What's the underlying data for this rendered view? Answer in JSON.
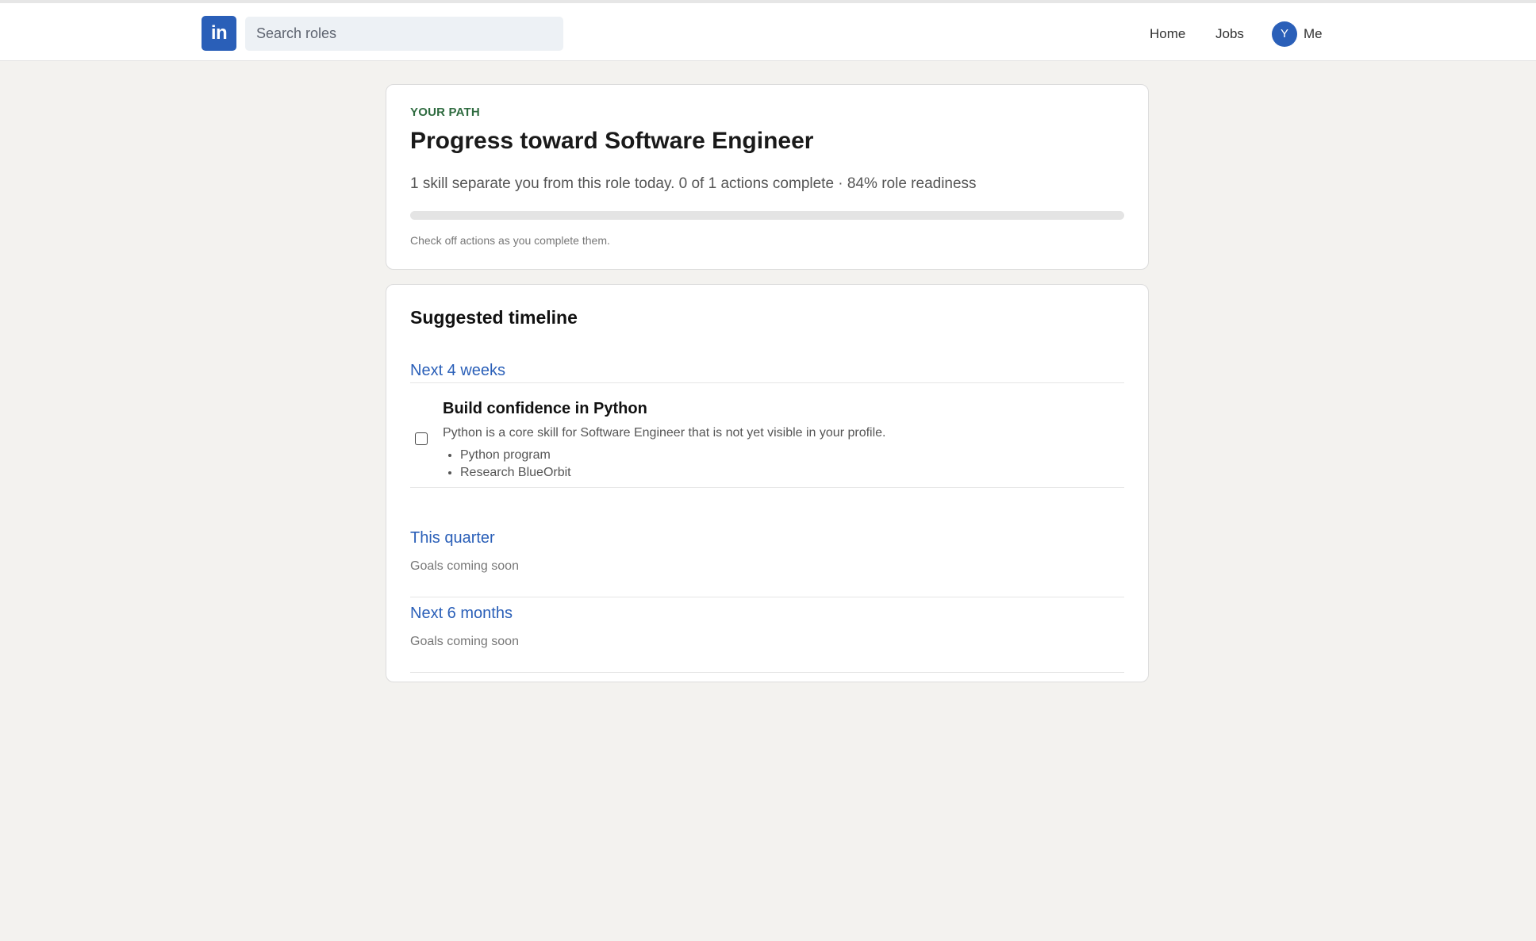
{
  "header": {
    "logo_text": "in",
    "search_placeholder": "Search roles",
    "nav": {
      "home": "Home",
      "jobs": "Jobs",
      "me": "Me",
      "avatar_initial": "Y"
    }
  },
  "progress": {
    "eyebrow": "YOUR PATH",
    "title": "Progress toward Software Engineer",
    "summary": "1 skill separate you from this role today. 0 of 1 actions complete · 84% role readiness",
    "actions_completed_fraction": 0,
    "hint": "Check off actions as you complete them."
  },
  "timeline": {
    "title": "Suggested timeline",
    "periods": [
      {
        "label": "Next 4 weeks",
        "actions": [
          {
            "title": "Build confidence in Python",
            "description": "Python is a core skill for Software Engineer that is not yet visible in your profile.",
            "checked": false,
            "resources": [
              "Python program",
              "Research BlueOrbit"
            ]
          }
        ]
      },
      {
        "label": "This quarter",
        "empty_text": "Goals coming soon"
      },
      {
        "label": "Next 6 months",
        "empty_text": "Goals coming soon"
      }
    ]
  },
  "colors": {
    "brand": "#2a5fb8",
    "accent_green": "#2e6b3f",
    "page_background": "#f3f2ef"
  },
  "icons": {
    "logo": "linkedin-logo",
    "checkbox": "checkbox-unchecked"
  }
}
